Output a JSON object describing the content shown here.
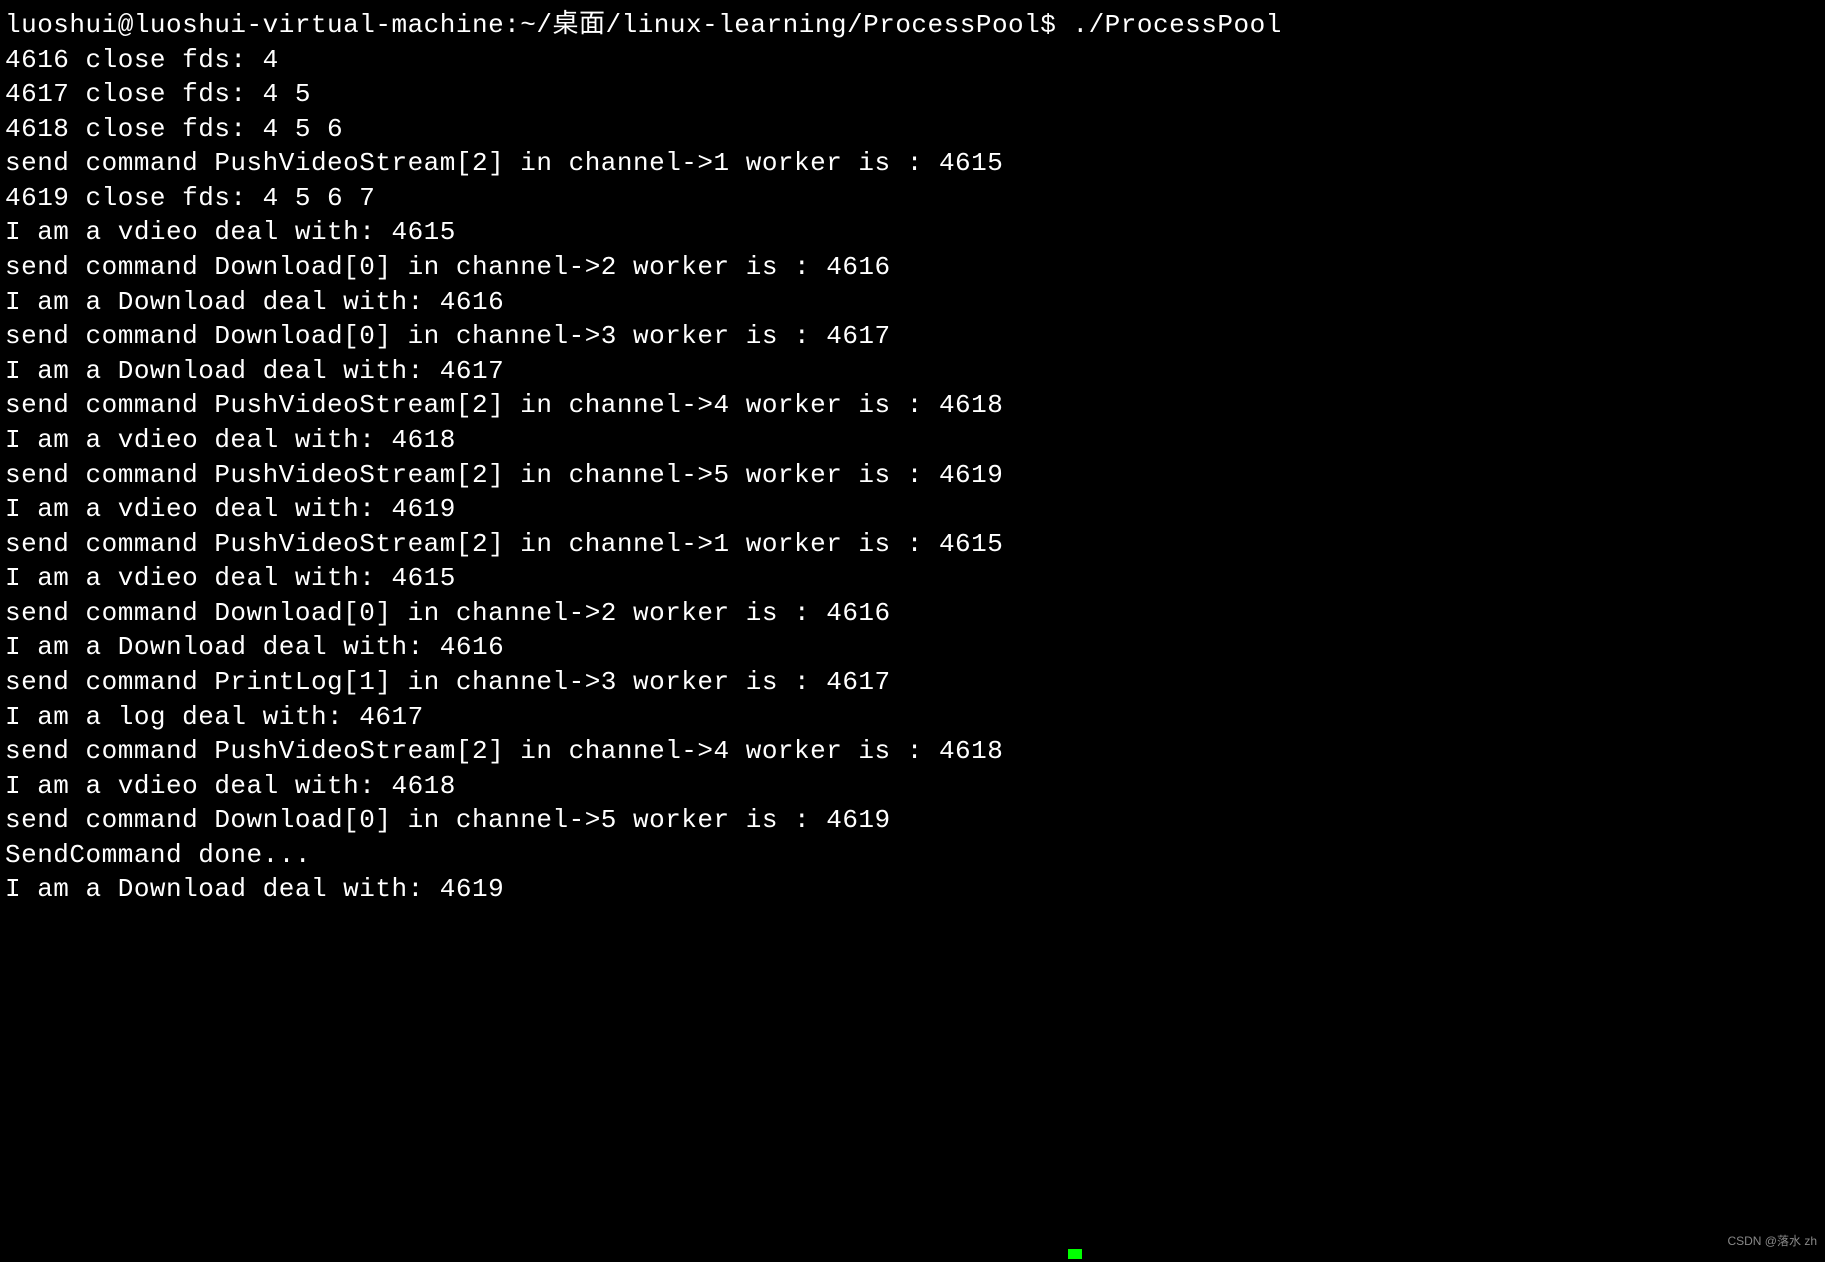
{
  "prompt": {
    "user": "luoshui",
    "host": "luoshui-virtual-machine",
    "path": "~/桌面/linux-learning/ProcessPool",
    "symbol": "$",
    "command": "./ProcessPool"
  },
  "lines": [
    "luoshui@luoshui-virtual-machine:~/桌面/linux-learning/ProcessPool$ ./ProcessPool",
    "4616 close fds: 4",
    "4617 close fds: 4 5",
    "4618 close fds: 4 5 6",
    "send command PushVideoStream[2] in channel->1 worker is : 4615",
    "4619 close fds: 4 5 6 7",
    "I am a vdieo deal with: 4615",
    "send command Download[0] in channel->2 worker is : 4616",
    "I am a Download deal with: 4616",
    "send command Download[0] in channel->3 worker is : 4617",
    "I am a Download deal with: 4617",
    "send command PushVideoStream[2] in channel->4 worker is : 4618",
    "I am a vdieo deal with: 4618",
    "send command PushVideoStream[2] in channel->5 worker is : 4619",
    "I am a vdieo deal with: 4619",
    "send command PushVideoStream[2] in channel->1 worker is : 4615",
    "I am a vdieo deal with: 4615",
    "send command Download[0] in channel->2 worker is : 4616",
    "I am a Download deal with: 4616",
    "send command PrintLog[1] in channel->3 worker is : 4617",
    "I am a log deal with: 4617",
    "send command PushVideoStream[2] in channel->4 worker is : 4618",
    "I am a vdieo deal with: 4618",
    "send command Download[0] in channel->5 worker is : 4619",
    "SendCommand done...",
    "I am a Download deal with: 4619"
  ],
  "watermark": "CSDN @落水 zh"
}
